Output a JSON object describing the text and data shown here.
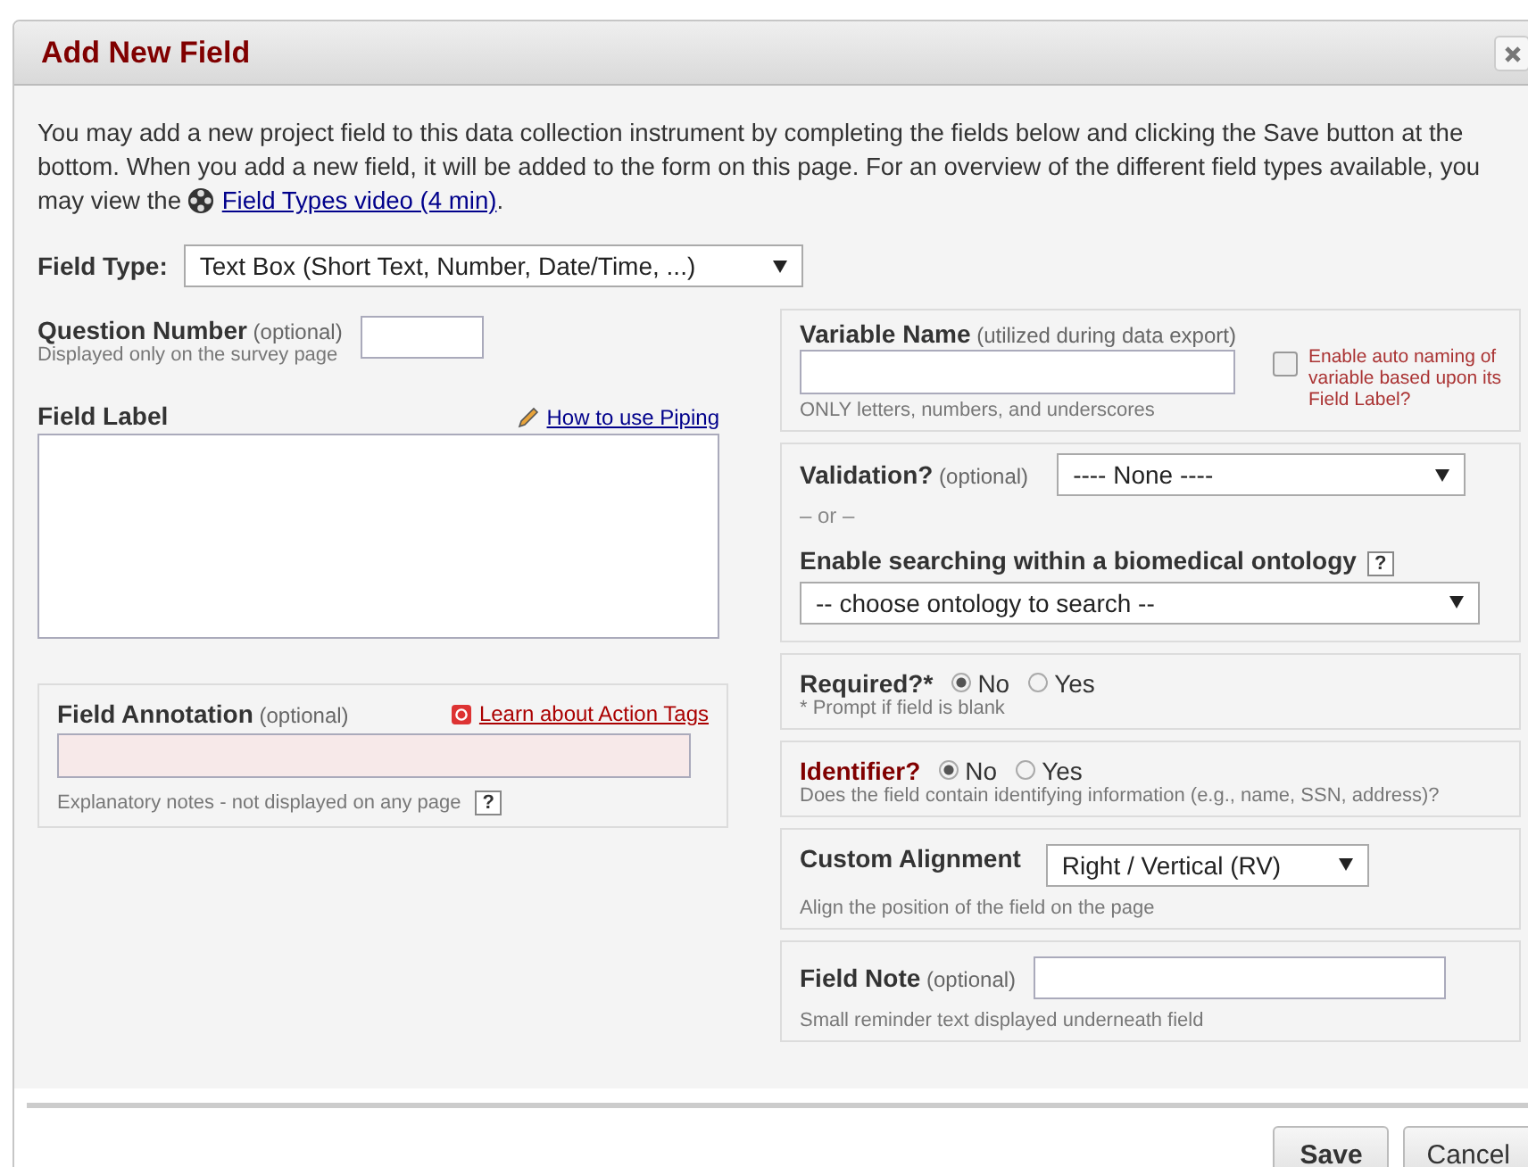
{
  "dialog": {
    "title": "Add New Field"
  },
  "intro": {
    "text": "You may add a new project field to this data collection instrument by completing the fields below and clicking the Save button at the bottom. When you add a new field, it will be added to the form on this page. For an overview of the different field types available, you may view the",
    "link": "Field Types video (4 min)",
    "end": "."
  },
  "field_type": {
    "label": "Field Type:",
    "value": "Text Box (Short Text, Number, Date/Time, ...)"
  },
  "question_number": {
    "label": "**Question Number** (optional)",
    "note": "Displayed only on the survey page"
  },
  "field_label": {
    "label": "Field Label",
    "link": "How to use Piping"
  },
  "field_annotation": {
    "label": "**Field Annotation** (optional)",
    "link": "Learn about Action Tags",
    "note": "Explanatory notes - not displayed on any page",
    "help": "?"
  },
  "variable_name": {
    "label": "**Variable Name** (utilized during data export)",
    "note": "ONLY letters, numbers, and underscores",
    "auto_naming": {
      "label": "Enable auto naming of variable based upon its Field Label?",
      "checked": false
    }
  },
  "validation": {
    "label": "**Validation?** (optional)",
    "value": "---- None ----",
    "separator": "– or –",
    "ontology_label": "Enable searching within a biomedical ontology",
    "help": "?",
    "ontology_value": "-- choose ontology to search --"
  },
  "required": {
    "label": "Required?*",
    "options": [
      {
        "label": "No",
        "selected": true
      },
      {
        "label": "Yes",
        "selected": false
      }
    ],
    "note": "* Prompt if field is blank"
  },
  "identifier": {
    "label": "Identifier?",
    "options": [
      {
        "label": "No",
        "selected": true
      },
      {
        "label": "Yes",
        "selected": false
      }
    ],
    "note": "Does the field contain identifying information (e.g., name, SSN, address)?"
  },
  "alignment": {
    "label": "Custom Alignment",
    "value": "Right / Vertical (RV)",
    "note": "Align the position of the field on the page"
  },
  "field_note": {
    "label": "**Field Note** (optional)",
    "note": "Small reminder text displayed underneath field"
  },
  "buttons": [
    {
      "label": "Save",
      "kind": "primary"
    },
    {
      "label": "Cancel",
      "kind": "secondary"
    }
  ]
}
